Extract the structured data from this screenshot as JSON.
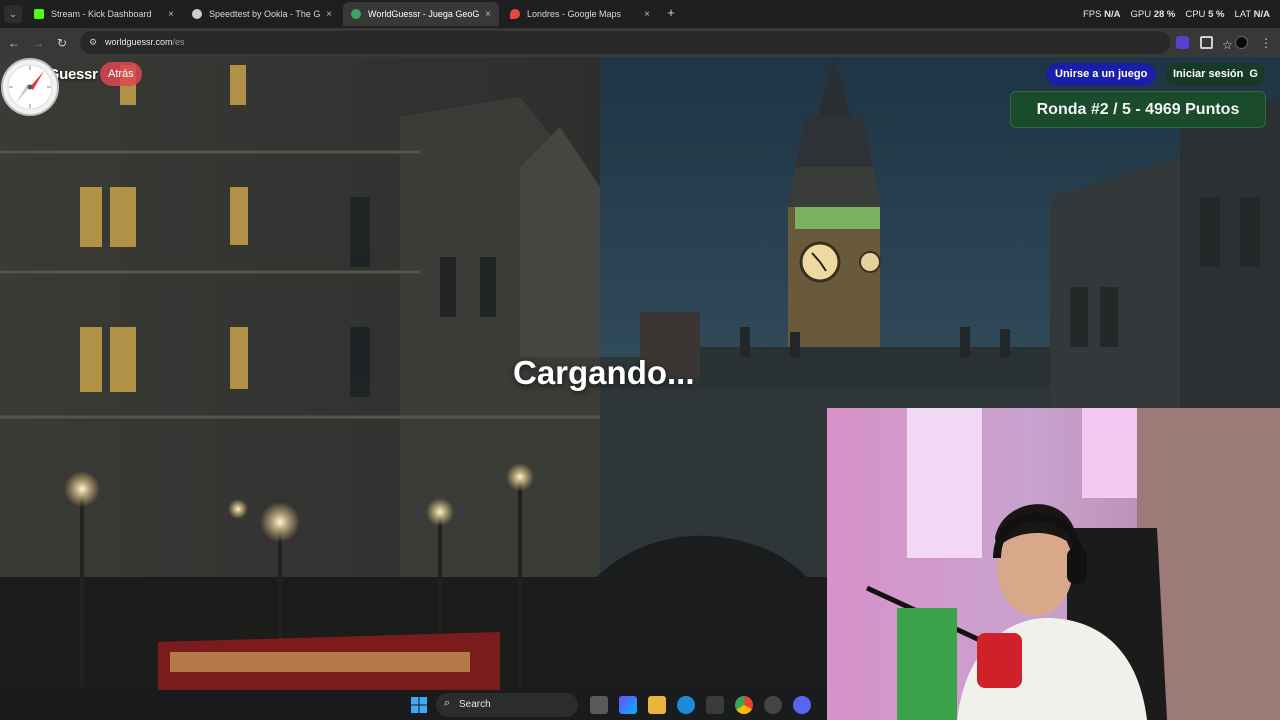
{
  "browser": {
    "tabs": [
      {
        "title": "Stream - Kick Dashboard",
        "favicon_color": "#53fc18",
        "active": false
      },
      {
        "title": "Speedtest by Ookla - The Global",
        "favicon_color": "#cfcfcf",
        "active": false
      },
      {
        "title": "WorldGuessr - Juega GeoGuessr",
        "favicon_color": "#3aa55d",
        "active": true
      },
      {
        "title": "Londres - Google Maps",
        "favicon_color": "#e8453c",
        "active": false
      }
    ],
    "close_glyph": "×",
    "new_tab_glyph": "+",
    "url_host": "worldguessr.com",
    "url_path": "/es"
  },
  "perf_overlay": {
    "fps_label": "FPS",
    "fps_value": "N/A",
    "gpu_label": "GPU",
    "gpu_value": "28 %",
    "cpu_label": "CPU",
    "cpu_value": "5 %",
    "lat_label": "LAT",
    "lat_value": "N/A"
  },
  "game": {
    "logo": "WorldGuessr",
    "back_label": "Atrás",
    "join_label": "Unirse a un juego",
    "login_label": "Iniciar sesión",
    "login_icon_glyph": "G",
    "round_text": "Ronda #2 / 5 - 4969 Puntos",
    "loading_text": "Cargando..."
  },
  "taskbar": {
    "search_label": "Search"
  },
  "colors": {
    "accent_green": "#1a4b2a",
    "join_blue": "#1a1fa8",
    "back_red": "#dc4650"
  }
}
